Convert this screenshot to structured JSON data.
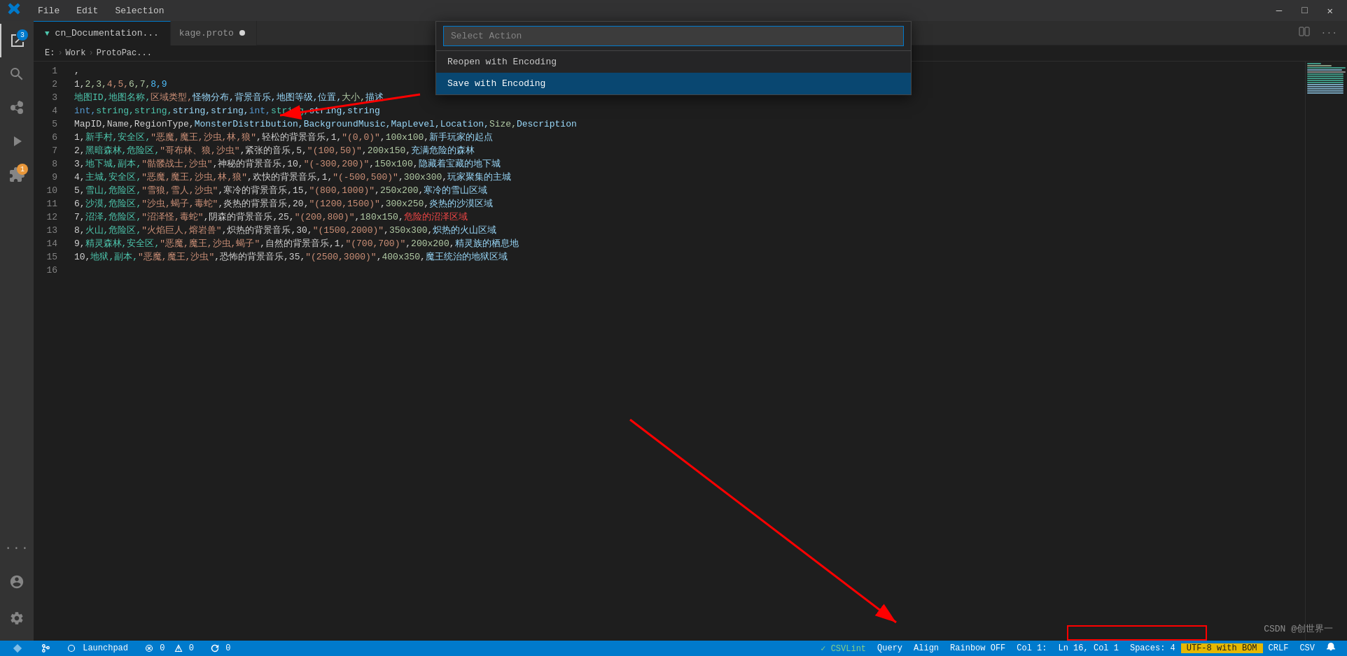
{
  "titlebar": {
    "icon": "VS",
    "menu_items": [
      "File",
      "Edit",
      "Selection"
    ],
    "window_controls": [
      "minimize",
      "maximize",
      "close"
    ]
  },
  "command_palette": {
    "placeholder": "Select Action",
    "options": [
      {
        "label": "Reopen with Encoding",
        "selected": false
      },
      {
        "label": "Save with Encoding",
        "selected": true
      }
    ]
  },
  "breadcrumb": {
    "items": [
      "E:",
      "Work",
      "ProtoPac..."
    ]
  },
  "tab": {
    "label": "cn_Documentation...",
    "secondary_label": "kage.proto",
    "dirty": true
  },
  "lines": [
    {
      "num": "1",
      "content": ","
    },
    {
      "num": "2",
      "content": "1,2,3,4,5,6,7,8,9"
    },
    {
      "num": "3",
      "content": "地图ID,地图名称,区域类型,怪物分布,背景音乐,地图等级,位置,大小,描述"
    },
    {
      "num": "4",
      "content": "int,string,string,string,string,int,string,string,string"
    },
    {
      "num": "5",
      "content": "MapID,Name,RegionType,MonsterDistribution,BackgroundMusic,MapLevel,Location,Size,Description"
    },
    {
      "num": "6",
      "content": "1,新手村,安全区,\"恶魔,魔王,沙虫,林,狼\",轻松的背景音乐,1,\"(0,0)\",100x100,新手玩家的起点"
    },
    {
      "num": "7",
      "content": "2,黑暗森林,危险区,\"哥布林,狼,沙虫\",紧张的音乐,5,\"(100,50)\",200x150,充满危险的森林"
    },
    {
      "num": "8",
      "content": "3,地下城,副本,\"骷髅战士,沙虫\",神秘的背景音乐,10,\"(-300,200)\",150x100,隐藏着宝藏的地下城"
    },
    {
      "num": "9",
      "content": "4,主城,安全区,\"恶魔,魔王,沙虫,林,狼\",欢快的背景音乐,1,\"(-500,500)\",300x300,玩家聚集的主城"
    },
    {
      "num": "10",
      "content": "5,雪山,危险区,\"雪狼,雪人,沙虫\",寒冷的背景音乐,15,\"(800,1000)\",250x200,寒冷的雪山区域"
    },
    {
      "num": "11",
      "content": "6,沙漠,危险区,\"沙虫,蝎子,毒蛇\",炎热的背景音乐,20,\"(1200,1500)\",300x250,炎热的沙漠区域"
    },
    {
      "num": "12",
      "content": "7,沼泽,危险区,\"沼泽怪,毒蛇\",阴森的背景音乐,25,\"(200,800)\",180x150,危险的沼泽区域"
    },
    {
      "num": "13",
      "content": "8,火山,危险区,\"火焰巨人,熔岩兽\",炽热的背景音乐,30,\"(1500,2000)\",350x300,炽热的火山区域"
    },
    {
      "num": "14",
      "content": "9,精灵森林,安全区,\"恶魔,魔王,沙虫,蝎子\",自然的背景音乐,1,\"(700,700)\",200x200,精灵族的栖息地"
    },
    {
      "num": "15",
      "content": "10,地狱,副本,\"恶魔,魔王,沙虫\",恐怖的背景音乐,35,\"(2500,3000)\",400x350,魔王统治的地狱区域"
    },
    {
      "num": "16",
      "content": ""
    }
  ],
  "status_bar": {
    "left": {
      "git_icon": "⎇",
      "launchpad": "Launchpad",
      "errors": "0",
      "warnings": "0",
      "sync_icon": "0"
    },
    "right": {
      "csvlint": "CSVLint",
      "query": "Query",
      "align": "Align",
      "rainbow": "Rainbow OFF",
      "col": "Col 1:",
      "position": "Ln 16, Col 1",
      "spaces": "Spaces: 4",
      "encoding": "UTF-8 with BOM",
      "line_ending": "CRLF",
      "language": "CSV"
    }
  },
  "activity_bar": {
    "items": [
      {
        "name": "explorer",
        "icon": "📄",
        "badge": null
      },
      {
        "name": "search",
        "icon": "🔍",
        "badge": null
      },
      {
        "name": "source-control",
        "icon": "⎇",
        "badge": null
      },
      {
        "name": "run",
        "icon": "▶",
        "badge": null
      },
      {
        "name": "extensions",
        "icon": "⬛",
        "badge": "1"
      },
      {
        "name": "more",
        "icon": "···",
        "badge": null
      }
    ],
    "bottom": [
      {
        "name": "accounts",
        "icon": "👤"
      },
      {
        "name": "settings",
        "icon": "⚙"
      }
    ]
  }
}
